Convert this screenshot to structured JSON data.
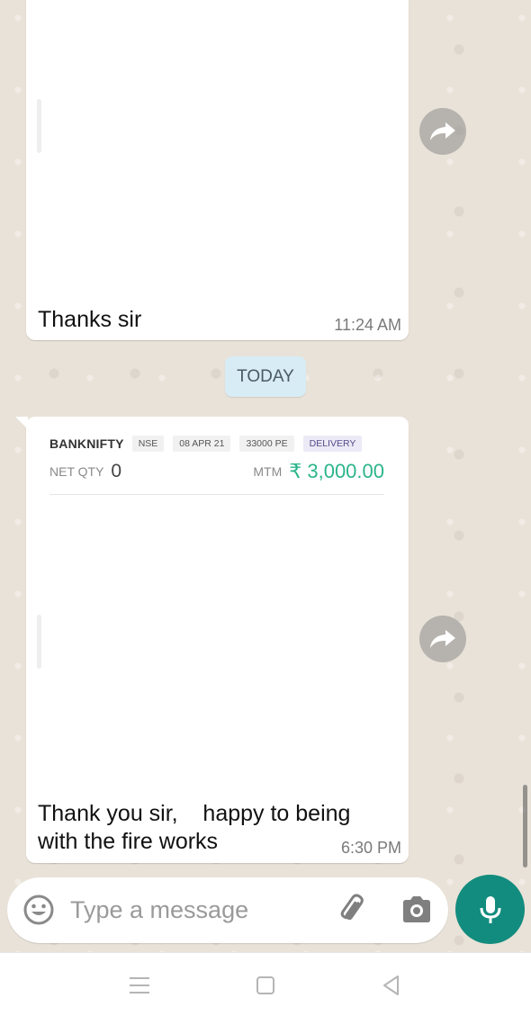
{
  "messages": [
    {
      "text": "Thanks sir",
      "time": "11:24 AM"
    },
    {
      "trade": {
        "symbol": "BANKNIFTY",
        "tags": [
          "NSE",
          "08 APR 21",
          "33000 PE",
          "DELIVERY"
        ],
        "net_qty_label": "NET QTY",
        "net_qty": "0",
        "mtm_label": "MTM",
        "mtm_value": "₹ 3,000.00",
        "mtm_color": "#2bb58a"
      },
      "text": "Thank you sir,    happy to being with the fire works",
      "time": "6:30 PM"
    }
  ],
  "date_divider": "TODAY",
  "composer": {
    "placeholder": "Type a message"
  },
  "icons": {
    "forward": "forward-icon",
    "emoji": "emoji-icon",
    "attach": "paperclip-icon",
    "camera": "camera-icon",
    "mic": "microphone-icon",
    "nav_menu": "menu-icon",
    "nav_home": "home-icon",
    "nav_back": "back-icon"
  },
  "colors": {
    "accent": "#128c7e",
    "chat_bg": "#e9e2d8",
    "date_chip": "#d8ecf5"
  }
}
